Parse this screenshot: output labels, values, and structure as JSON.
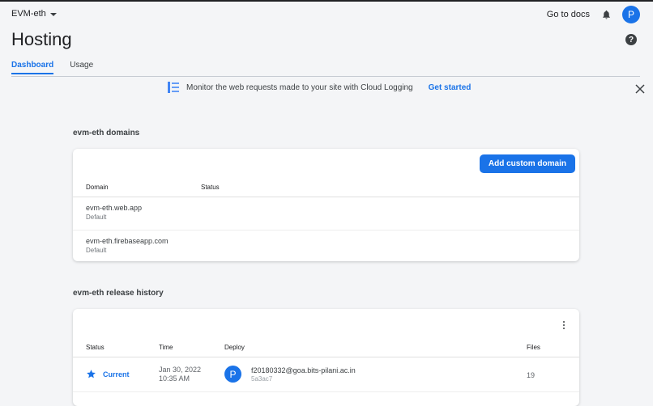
{
  "header": {
    "project_name": "EVM-eth",
    "docs_link": "Go to docs",
    "avatar_initial": "P"
  },
  "page": {
    "title": "Hosting",
    "help_icon": "?"
  },
  "tabs": [
    {
      "label": "Dashboard",
      "active": true
    },
    {
      "label": "Usage",
      "active": false
    }
  ],
  "banner": {
    "message": "Monitor the web requests made to your site with Cloud Logging",
    "cta": "Get started"
  },
  "domains_section": {
    "title": "evm-eth domains",
    "add_button": "Add custom domain",
    "columns": [
      "Domain",
      "Status"
    ],
    "rows": [
      {
        "domain": "evm-eth.web.app",
        "sub": "Default"
      },
      {
        "domain": "evm-eth.firebaseapp.com",
        "sub": "Default"
      }
    ]
  },
  "release_section": {
    "title": "evm-eth release history",
    "columns": [
      "Status",
      "Time",
      "Deploy",
      "Files"
    ],
    "rows": [
      {
        "status": "Current",
        "date": "Jan 30, 2022",
        "time": "10:35 AM",
        "avatar_initial": "P",
        "email": "f20180332@goa.bits-pilani.ac.in",
        "hash": "5a3ac7",
        "files": "19"
      }
    ]
  },
  "colors": {
    "accent": "#1a73e8",
    "background": "#f4f5f7"
  },
  "icons": [
    "chevron-down-icon",
    "bell-icon",
    "help-icon",
    "logging-icon",
    "close-icon",
    "more-vert-icon",
    "star-icon"
  ]
}
